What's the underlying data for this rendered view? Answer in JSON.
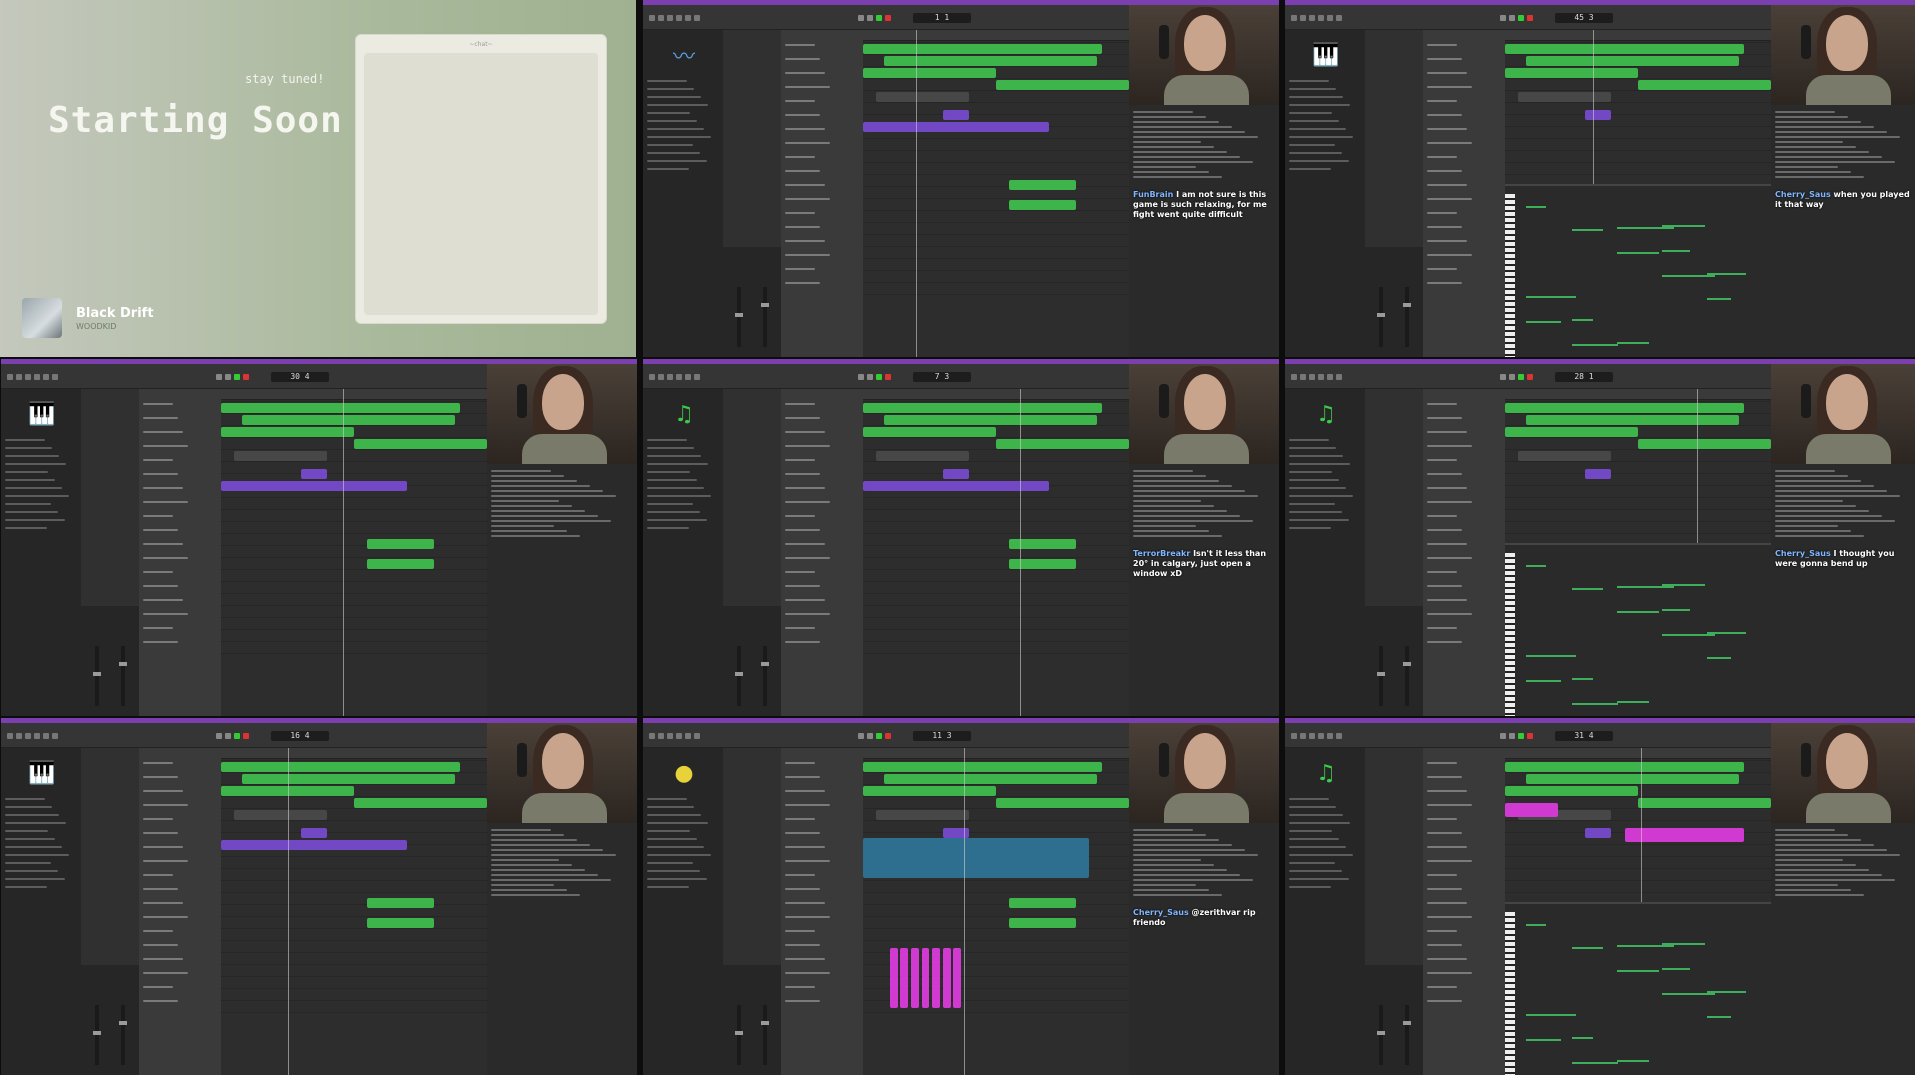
{
  "intro": {
    "stay": "stay tuned!",
    "title": "Starting Soon",
    "chat_label": "~chat~",
    "song": "Black Drift",
    "artist": "WOODKID"
  },
  "panels": [
    {
      "lcd": "1 1",
      "icon": "waveform-icon",
      "icon_glyph": "〰",
      "icon_color": "#5a9ee0",
      "chat": [
        {
          "user": "FunBrain",
          "text": "I am not sure is this game is such relaxing, for me fight went quite difficult"
        }
      ],
      "pianoroll": false
    },
    {
      "lcd": "45 3",
      "icon": "piano-icon",
      "icon_glyph": "🎹",
      "icon_color": "#3cc94a",
      "chat": [
        {
          "user": "Cherry_Saus",
          "text": "when you played it that way"
        }
      ],
      "pianoroll": true
    },
    {
      "lcd": "30 4",
      "icon": "piano-icon",
      "icon_glyph": "🎹",
      "icon_color": "#3cc94a",
      "chat": [],
      "pianoroll": false
    },
    {
      "lcd": "7 3",
      "icon": "music-note-icon",
      "icon_glyph": "♫",
      "icon_color": "#3cc94a",
      "chat": [
        {
          "user": "TerrorBreakr",
          "text": "Isn't it less than 20° in calgary, just open a window xD"
        }
      ],
      "pianoroll": false
    },
    {
      "lcd": "28 1",
      "icon": "music-note-icon",
      "icon_glyph": "♫",
      "icon_color": "#3cc94a",
      "chat": [
        {
          "user": "Cherry_Saus",
          "text": "I thought you were gonna bend up"
        }
      ],
      "pianoroll": true
    },
    {
      "lcd": "16 4",
      "icon": "piano-icon",
      "icon_glyph": "🎹",
      "icon_color": "#3cc94a",
      "chat": [],
      "pianoroll": false
    },
    {
      "lcd": "11 3",
      "icon": "tuner-icon",
      "icon_glyph": "●",
      "icon_color": "#e8d23a",
      "chat": [
        {
          "user": "Cherry_Saus",
          "text": "@zerithvar rip friendo"
        }
      ],
      "pianoroll": false
    },
    {
      "lcd": "31 4",
      "icon": "music-note-icon",
      "icon_glyph": "♫",
      "icon_color": "#3cc94a",
      "chat": [],
      "pianoroll": true
    }
  ],
  "colors": {
    "green": "#3fc44f",
    "purple": "#7a4bd6",
    "teal": "#2e6f8f",
    "magenta": "#d13ad0",
    "accent": "#7b3fb0"
  }
}
